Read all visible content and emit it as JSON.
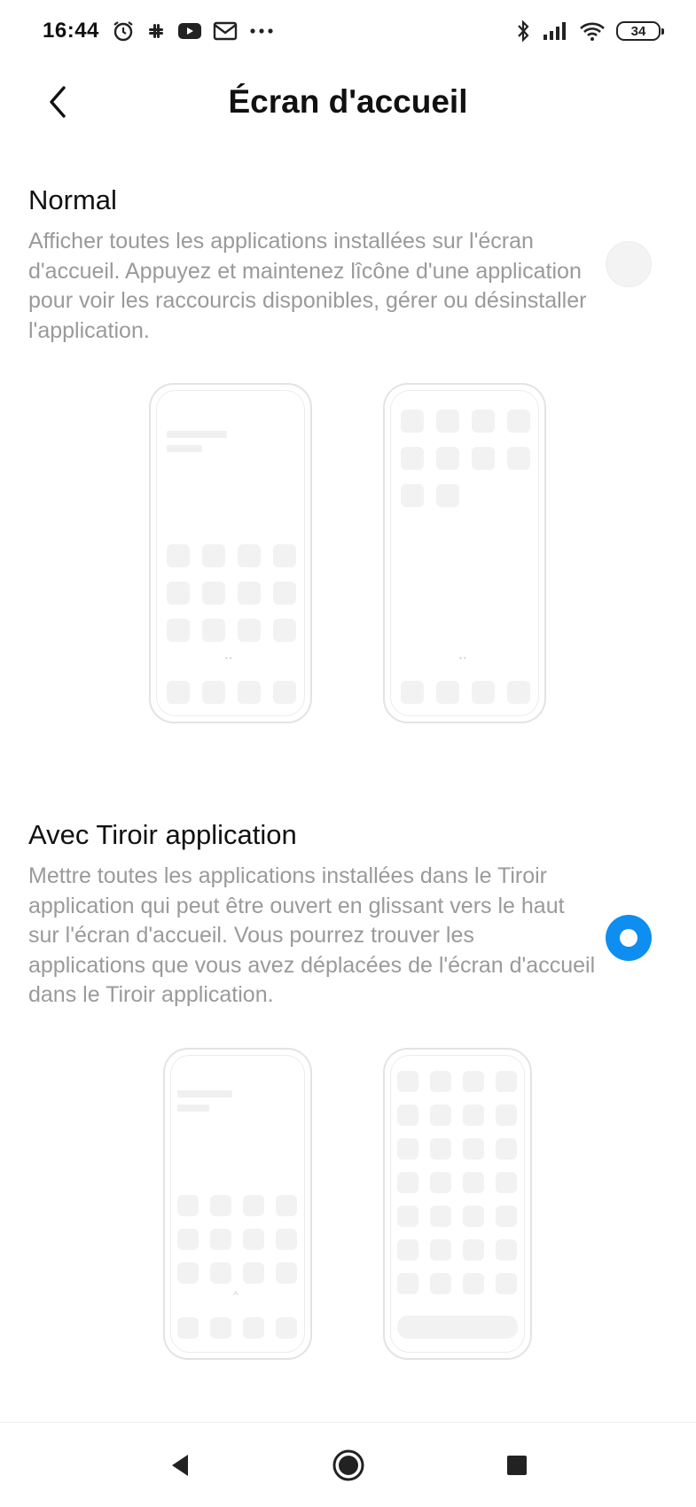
{
  "status_bar": {
    "time": "16:44",
    "left_icons": [
      "alarm-icon",
      "slack-icon",
      "youtube-icon",
      "gmail-icon",
      "more-notifications-icon"
    ],
    "right_icons": [
      "bluetooth-icon",
      "signal-icon",
      "wifi-icon"
    ],
    "battery": "34"
  },
  "header": {
    "title": "Écran d'accueil",
    "back_icon": "back-arrow-icon"
  },
  "options": [
    {
      "title": "Normal",
      "description": "Afficher toutes les applications installées sur l'écran d'accueil. Appuyez et maintenez lîcône d'une application pour voir les raccourcis disponibles, gérer ou désinstaller l'application.",
      "selected": false
    },
    {
      "title": "Avec Tiroir application",
      "description": "Mettre toutes les applications installées dans le Tiroir application qui peut être ouvert en glissant vers le haut sur l'écran d'accueil. Vous pourrez trouver les applications que vous avez déplacées de l'écran d'accueil dans le Tiroir application.",
      "selected": true
    }
  ],
  "colors": {
    "accent": "#0d8ef0",
    "description_text": "#9a9a9a",
    "illustration_tile": "#f2f2f2"
  },
  "nav_bar": {
    "icons": [
      "nav-back-icon",
      "nav-home-icon",
      "nav-recents-icon"
    ]
  }
}
